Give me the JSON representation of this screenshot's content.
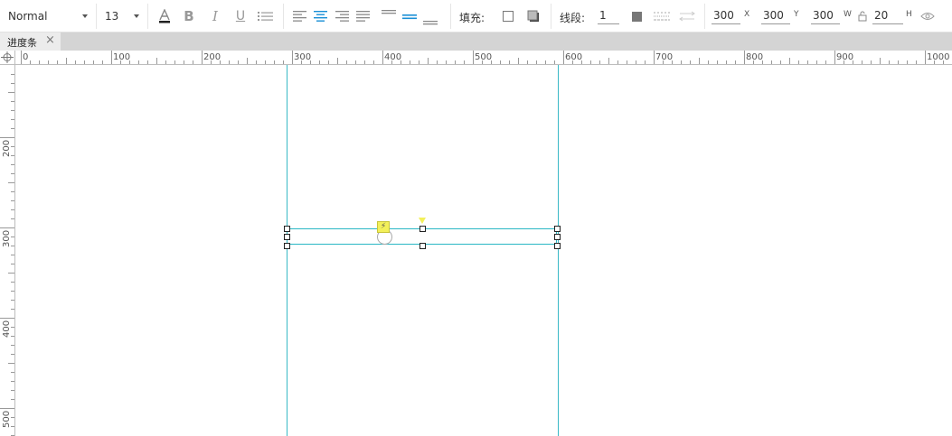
{
  "toolbar": {
    "font_style": "Normal",
    "font_size": "13",
    "fill_label": "填充:",
    "line_label": "线段:",
    "line_width": "1",
    "x_value": "300",
    "x_unit": "X",
    "y_value": "300",
    "y_unit": "Y",
    "w_value": "300",
    "w_unit": "W",
    "h_value": "20",
    "h_unit": "H"
  },
  "tab": {
    "label": "进度条",
    "close": "×"
  },
  "ruler": {
    "h_labels": [
      "0",
      "100",
      "200",
      "300",
      "400",
      "500",
      "600",
      "700",
      "800",
      "900",
      "1000"
    ],
    "v_labels": [
      "200",
      "300",
      "400",
      "500"
    ]
  },
  "colors": {
    "guide": "#39b9c6",
    "accent": "#1a8fd6",
    "hotspot": "#f3f05a"
  }
}
